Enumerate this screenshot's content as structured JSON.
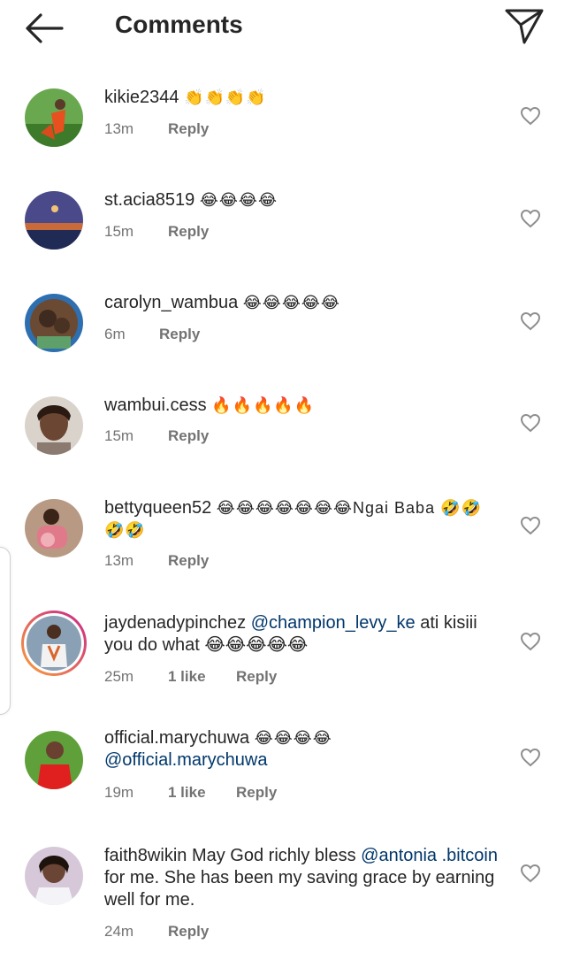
{
  "header": {
    "title": "Comments"
  },
  "comments": [
    {
      "username": "kikie2344",
      "text": "👏👏👏👏",
      "time": "13m",
      "likes": "",
      "reply_label": "Reply"
    },
    {
      "username": "st.acia8519",
      "text": "😂😂😂😂",
      "time": "15m",
      "likes": "",
      "reply_label": "Reply"
    },
    {
      "username": "carolyn_wambua",
      "text": "😂😂😂😂😂",
      "time": "6m",
      "likes": "",
      "reply_label": "Reply"
    },
    {
      "username": "wambui.cess",
      "text": "🔥🔥🔥🔥🔥",
      "time": "15m",
      "likes": "",
      "reply_label": "Reply"
    },
    {
      "username": "bettyqueen52",
      "text": "😂😂😂😂😂😂😂Ngai Baba 🤣🤣🤣🤣",
      "time": "13m",
      "likes": "",
      "reply_label": "Reply"
    },
    {
      "username": "jaydenadypinchez",
      "mention": "@champion_levy_ke",
      "text": "ati kisiii you do what 😂😂😂😂😂",
      "time": "25m",
      "likes": "1 like",
      "reply_label": "Reply"
    },
    {
      "username": "official.marychuwa",
      "text": "😂😂😂😂",
      "mention": "@official.marychuwa",
      "time": "19m",
      "likes": "1 like",
      "reply_label": "Reply"
    },
    {
      "username": "faith8wikin",
      "text_before": "May God richly bless",
      "mention": "@antonia .bitcoin",
      "text_after": "for me. She has been my saving grace by earning well for me.",
      "time": "24m",
      "likes": "",
      "reply_label": "Reply"
    }
  ],
  "colors": {
    "text": "#262626",
    "secondary": "#737373",
    "mention": "#00376b",
    "story_ring_start": "#f9a13a",
    "story_ring_end": "#c8258c"
  },
  "icons": {
    "back": "arrow-left-icon",
    "share": "paper-plane-icon",
    "like": "heart-outline-icon"
  }
}
